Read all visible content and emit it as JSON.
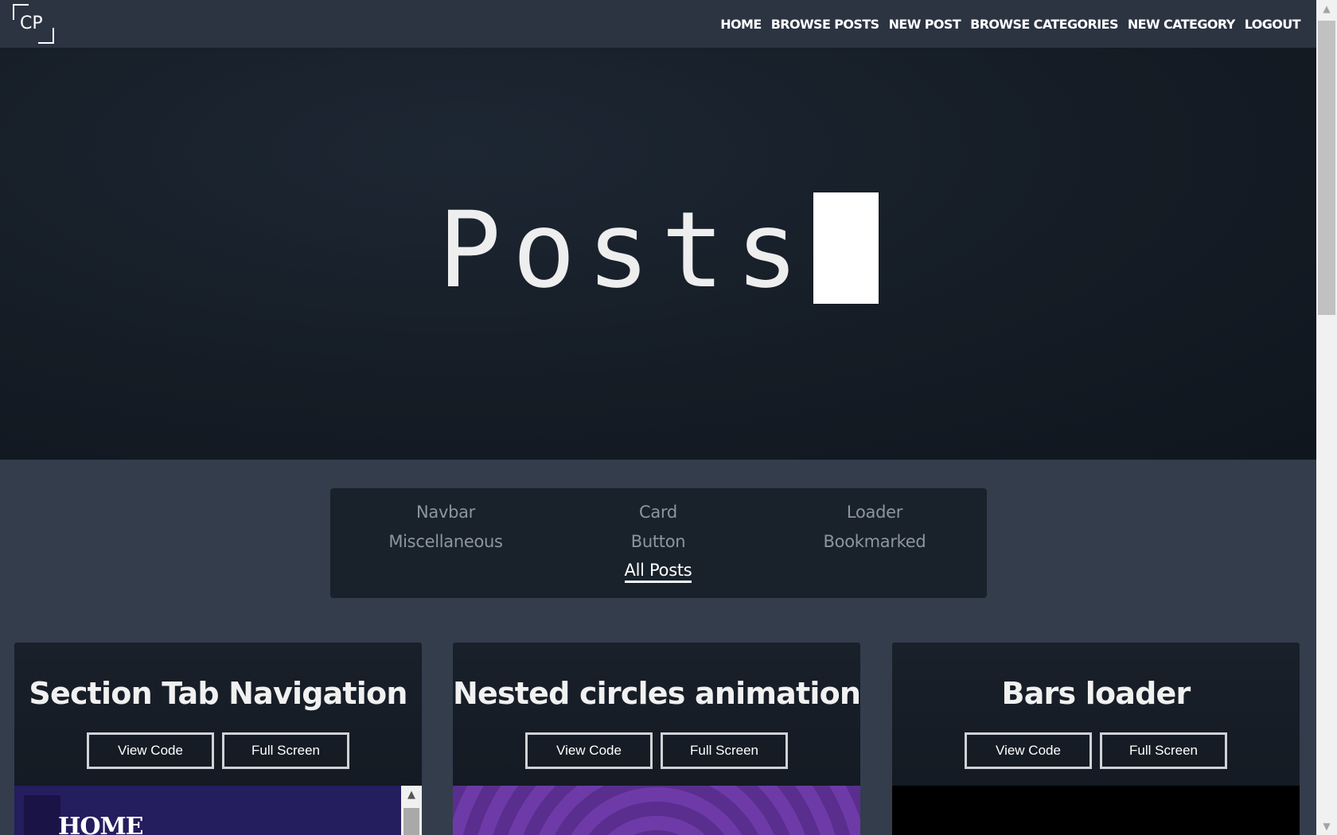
{
  "logo": {
    "text": "CP"
  },
  "nav": {
    "items": [
      "HOME",
      "BROWSE POSTS",
      "NEW POST",
      "BROWSE CATEGORIES",
      "NEW CATEGORY",
      "LOGOUT"
    ]
  },
  "hero": {
    "title": "Posts"
  },
  "filters": {
    "items": [
      "Navbar",
      "Card",
      "Loader",
      "Miscellaneous",
      "Button",
      "Bookmarked",
      "All Posts"
    ],
    "active": "All Posts"
  },
  "cards": [
    {
      "title": "Section Tab Navigation",
      "view_code": "View Code",
      "full_screen": "Full Screen",
      "preview_text": "HOME"
    },
    {
      "title": "Nested circles animation",
      "view_code": "View Code",
      "full_screen": "Full Screen"
    },
    {
      "title": "Bars loader",
      "view_code": "View Code",
      "full_screen": "Full Screen"
    }
  ],
  "colors": {
    "page_bg": "#333d4c",
    "nav_bg": "#2c3442",
    "hero_bg": "#151c25",
    "panel_bg": "#19212a",
    "accent": "#ffffff"
  }
}
